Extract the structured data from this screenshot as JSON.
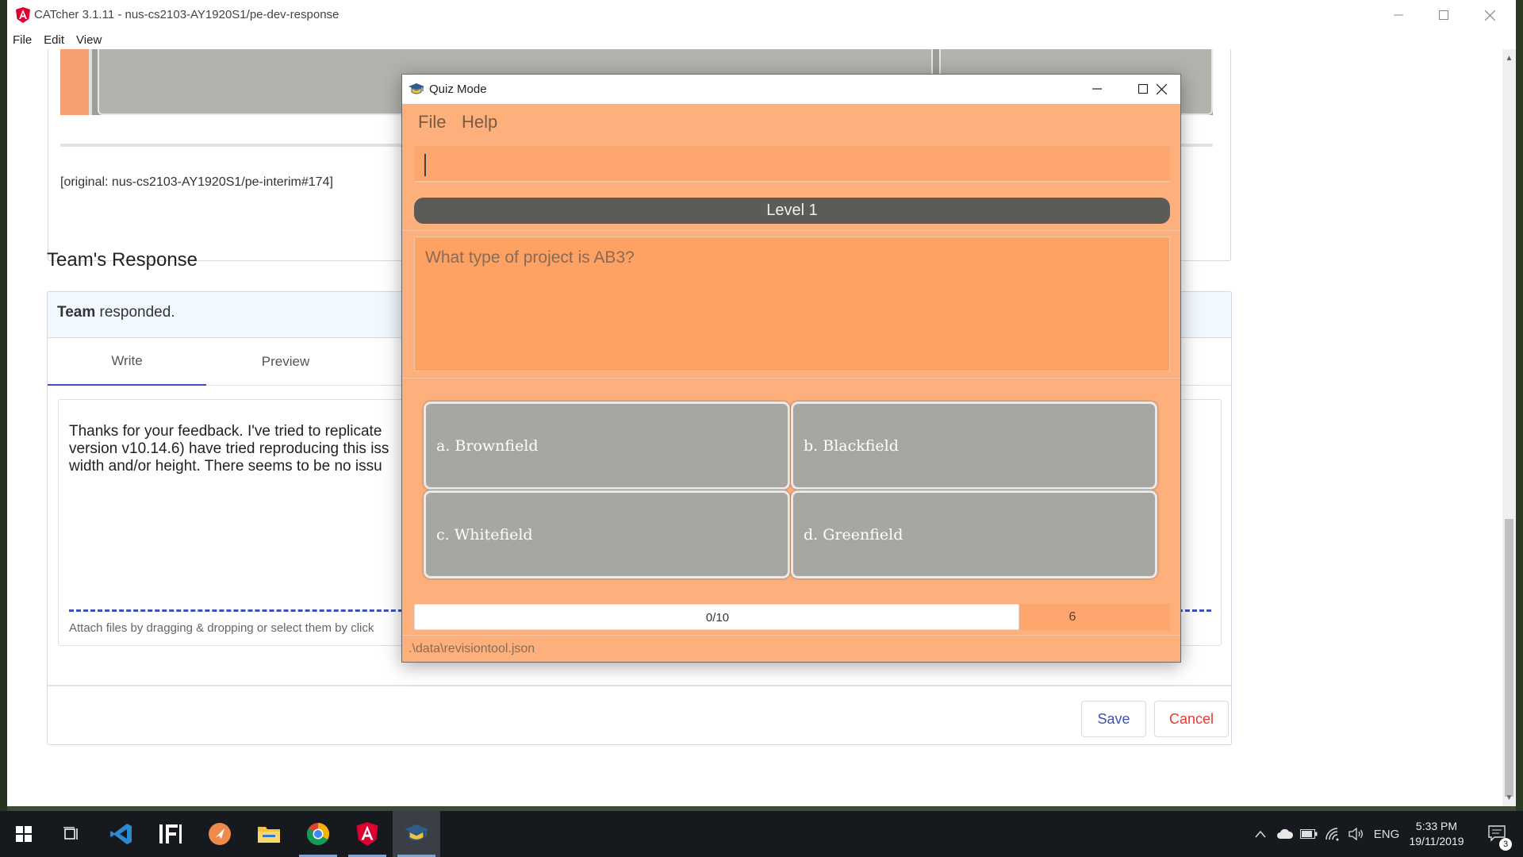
{
  "window": {
    "title": "CATcher 3.1.11 - nus-cs2103-AY1920S1/pe-dev-response",
    "menu": [
      "File",
      "Edit",
      "View"
    ]
  },
  "issue": {
    "original_ref": "[original: nus-cs2103-AY1920S1/pe-interim#174]"
  },
  "team_response": {
    "section_title": "Team's Response",
    "header_bold": "Team",
    "header_rest": " responded.",
    "tabs": [
      "Write",
      "Preview"
    ],
    "body_lines": [
      "Thanks for your feedback. I've tried to replicate",
      "version v10.14.6) have tried reproducing this iss",
      "width and/or height. There seems to be no issu"
    ],
    "attach_hint": "Attach files by dragging & dropping or select them by click",
    "save_label": "Save",
    "cancel_label": "Cancel"
  },
  "quiz": {
    "title": "Quiz Mode",
    "menu": [
      "File",
      "Help"
    ],
    "command_value": "",
    "level": "Level 1",
    "question": "What type of project is AB3?",
    "options": [
      "a. Brownfield",
      "b. Blackfield",
      "c. Whitefield",
      "d. Greenfield"
    ],
    "progress_text": "0/10",
    "progress_fraction": 0,
    "score": "6",
    "status_path": ".\\data\\revisiontool.json"
  },
  "taskbar": {
    "apps": [
      "start-icon",
      "task-view-icon",
      "vscode-icon",
      "intellij-icon",
      "app-orange-icon",
      "file-explorer-icon",
      "chrome-icon",
      "catcher-icon",
      "quiz-app-icon"
    ],
    "language": "ENG",
    "time": "5:33 PM",
    "date": "19/11/2019",
    "notification_count": "3"
  },
  "colors": {
    "quiz_background": "#fdb07c",
    "level_bar": "#5c5b57",
    "option_button": "#a8a6a1",
    "accent_blue": "#3f51b5",
    "cancel_red": "#e53935"
  }
}
